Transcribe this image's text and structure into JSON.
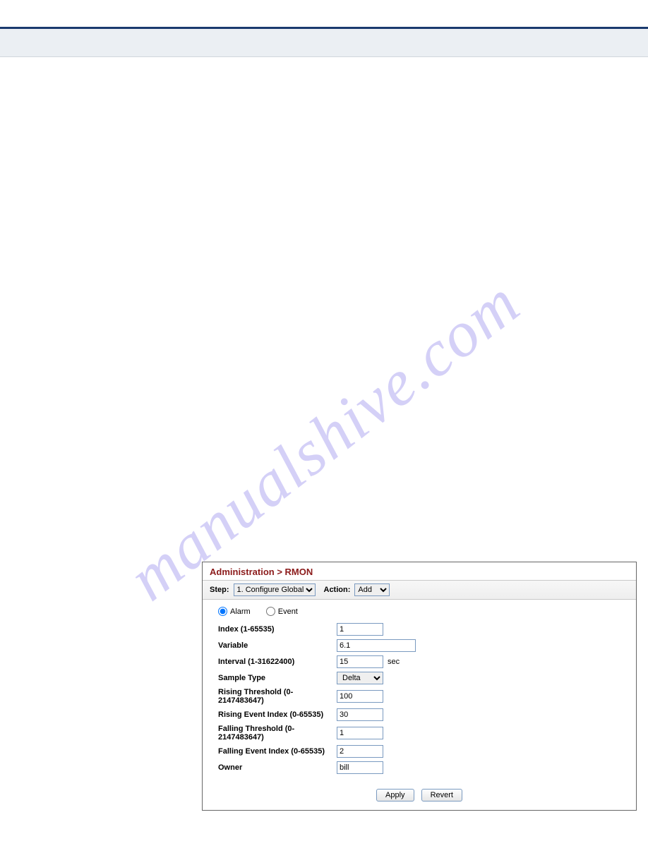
{
  "watermark": "manualshive.com",
  "panel": {
    "breadcrumb": "Administration > RMON",
    "step_label": "Step:",
    "step_value": "1. Configure Global",
    "action_label": "Action:",
    "action_value": "Add",
    "radios": {
      "alarm": "Alarm",
      "event": "Event"
    },
    "fields": {
      "index": {
        "label": "Index (1-65535)",
        "value": "1"
      },
      "variable": {
        "label": "Variable",
        "value": "6.1"
      },
      "interval": {
        "label": "Interval (1-31622400)",
        "value": "15",
        "suffix": "sec"
      },
      "sample_type": {
        "label": "Sample Type",
        "value": "Delta"
      },
      "rising_threshold": {
        "label": "Rising Threshold (0-2147483647)",
        "value": "100"
      },
      "rising_event_index": {
        "label": "Rising Event Index (0-65535)",
        "value": "30"
      },
      "falling_threshold": {
        "label": "Falling Threshold (0-2147483647)",
        "value": "1"
      },
      "falling_event_index": {
        "label": "Falling Event Index (0-65535)",
        "value": "2"
      },
      "owner": {
        "label": "Owner",
        "value": "bill"
      }
    },
    "buttons": {
      "apply": "Apply",
      "revert": "Revert"
    }
  }
}
